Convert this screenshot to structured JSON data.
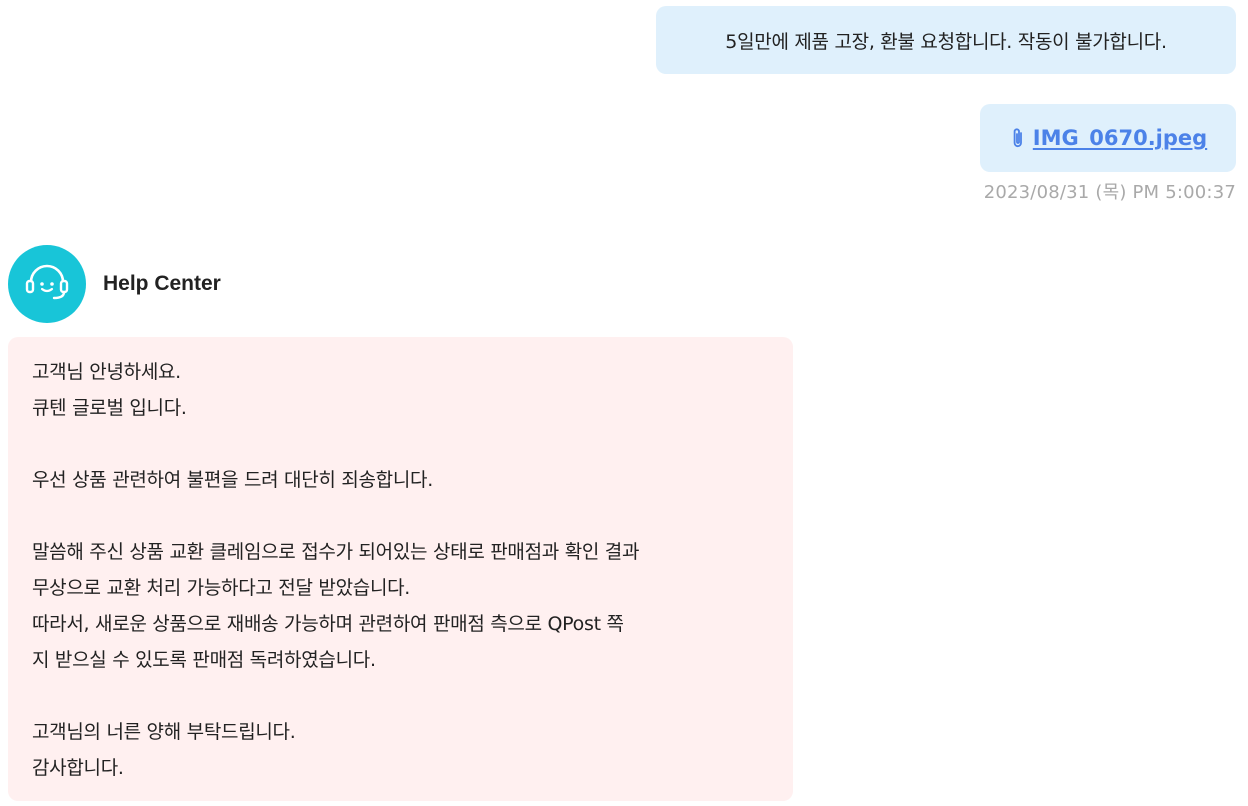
{
  "user_messages": {
    "text": "5일만에 제품 고장, 환불 요청합니다. 작동이 불가합니다.",
    "attachment_name": "IMG_0670.jpeg",
    "attachment_icon": "paperclip-icon",
    "timestamp": "2023/08/31 (목) PM 5:00:37"
  },
  "agent": {
    "name": "Help Center",
    "avatar_icon": "headset-icon",
    "avatar_color": "#18c5d8",
    "message_lines": [
      "고객님 안녕하세요.",
      "큐텐 글로벌 입니다.",
      "",
      "우선 상품 관련하여 불편을 드려 대단히 죄송합니다.",
      "",
      "말씀해 주신 상품 교환 클레임으로 접수가 되어있는 상태로 판매점과 확인 결과",
      "무상으로 교환 처리 가능하다고 전달 받았습니다.",
      "따라서, 새로운 상품으로 재배송 가능하며 관련하여 판매점 측으로 QPost 쪽",
      "지 받으실 수 있도록 판매점 독려하였습니다.",
      "",
      "고객님의 너른 양해 부탁드립니다.",
      "감사합니다."
    ]
  },
  "colors": {
    "user_bubble": "#dff0fc",
    "agent_bubble": "#fff0f0",
    "link": "#4c82e8",
    "timestamp": "#a9a9a9"
  }
}
